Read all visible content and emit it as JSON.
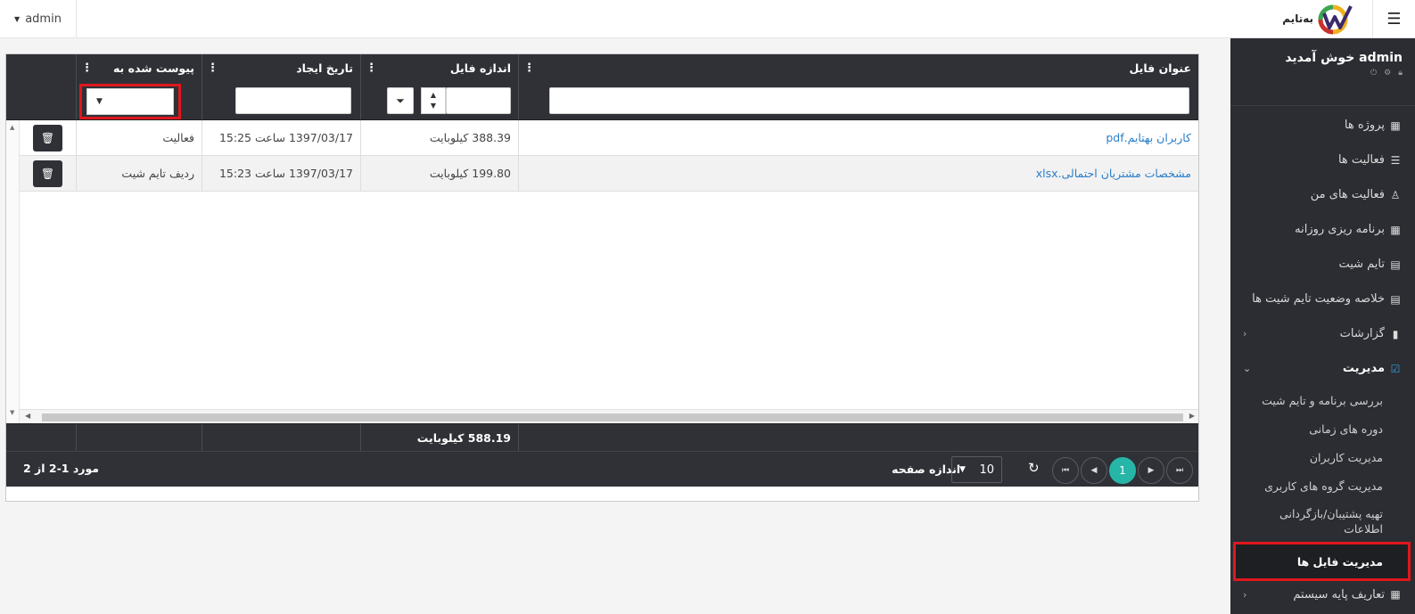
{
  "topbar": {
    "user": "admin",
    "logo_text": "به‌تایم"
  },
  "sidebar": {
    "welcome": "admin خوش آمدید",
    "items": [
      {
        "label": "پروژه ها",
        "icon": "cubes-icon"
      },
      {
        "label": "فعالیت ها",
        "icon": "tasks-icon"
      },
      {
        "label": "فعالیت های من",
        "icon": "user-tasks-icon"
      },
      {
        "label": "برنامه ریزی روزانه",
        "icon": "table-icon"
      },
      {
        "label": "تایم شیت",
        "icon": "calendar-icon"
      },
      {
        "label": "خلاصه وضعیت تایم شیت ها",
        "icon": "list-icon"
      },
      {
        "label": "گزارشات",
        "icon": "file-icon"
      },
      {
        "label": "مدیریت",
        "icon": "check-square-icon"
      }
    ],
    "sub_items": [
      "بررسی برنامه و تایم شیت",
      "دوره های زمانی",
      "مدیریت کاربران",
      "مدیریت گروه های کاربری",
      "تهیه پشتیبان/بازگردانی اطلاعات",
      "مدیریت فایل ها"
    ],
    "last_item": "تعاریف پایه سیستم"
  },
  "grid": {
    "columns": {
      "title": "عنوان فایل",
      "size": "اندازه فایل",
      "date": "تاریخ ایجاد",
      "attached": "پیوست شده به"
    },
    "rows": [
      {
        "title": "کاربران بهتایم.pdf",
        "size": "388.39 کیلوبایت",
        "date": "1397/03/17 ساعت 15:25",
        "attached": "فعالیت"
      },
      {
        "title": "مشخصات مشتریان احتمالی.xlsx",
        "size": "199.80 کیلوبایت",
        "date": "1397/03/17 ساعت 15:23",
        "attached": "ردیف تایم شیت"
      }
    ],
    "total_size": "588.19 کیلوبایت"
  },
  "pager": {
    "range": "مورد 1-2 از 2",
    "current_page": "1",
    "page_size": "10",
    "page_size_label": "اندازه صفحه"
  },
  "colors": {
    "sidebar_bg": "#2b2d33",
    "grid_header_bg": "#2f3137",
    "accent": "#26b6a8",
    "link": "#2a7fc9",
    "highlight": "#e0171d"
  }
}
